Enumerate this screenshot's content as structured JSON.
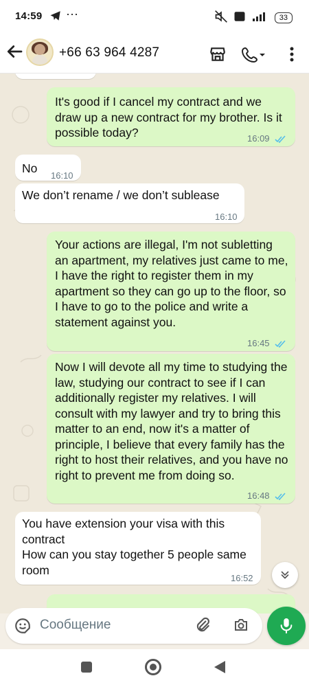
{
  "status": {
    "time": "14:59",
    "more": "···",
    "battery": "33"
  },
  "header": {
    "title": "+66 63 964 4287"
  },
  "messages": [
    {
      "dir": "out",
      "text": "It's good if I cancel my contract and we draw up a new contract for my brother. Is it possible today?",
      "time": "16:09"
    },
    {
      "dir": "in",
      "text": "No",
      "time": "16:10"
    },
    {
      "dir": "in",
      "text": "We don’t rename / we don’t sublease",
      "time": "16:10"
    },
    {
      "dir": "out",
      "text": "Your actions are illegal, I'm not subletting an apartment, my relatives just came to me, I have the right to register them in my apartment so they can go up to the floor, so I have to go to the police and write a statement against you.",
      "time": "16:45"
    },
    {
      "dir": "out",
      "text": "Now I will devote all my time to studying the law, studying our contract to see if I can additionally register my relatives. I will consult with my lawyer and try to bring this matter to an end, now it's a matter of principle, I believe that every family has the right to host their relatives, and you have no right to prevent me from doing so.",
      "time": "16:48"
    },
    {
      "dir": "in",
      "text": "You have extension your visa with this contract\nHow can you stay together 5 people same room",
      "time": "16:52"
    }
  ],
  "composer": {
    "placeholder": "Сообщение"
  },
  "icons": {
    "back": "arrow-left",
    "shop": "storefront",
    "call": "phone-dropdown",
    "more": "vertical-dots",
    "emoji": "sticker",
    "attach": "paperclip",
    "camera": "camera",
    "mic": "microphone",
    "scroll": "double-chevron-down"
  },
  "colors": {
    "outgoing": "#dcf8c6",
    "incoming": "#ffffff",
    "accent": "#1faa53",
    "read_ticks": "#53bdeb"
  }
}
